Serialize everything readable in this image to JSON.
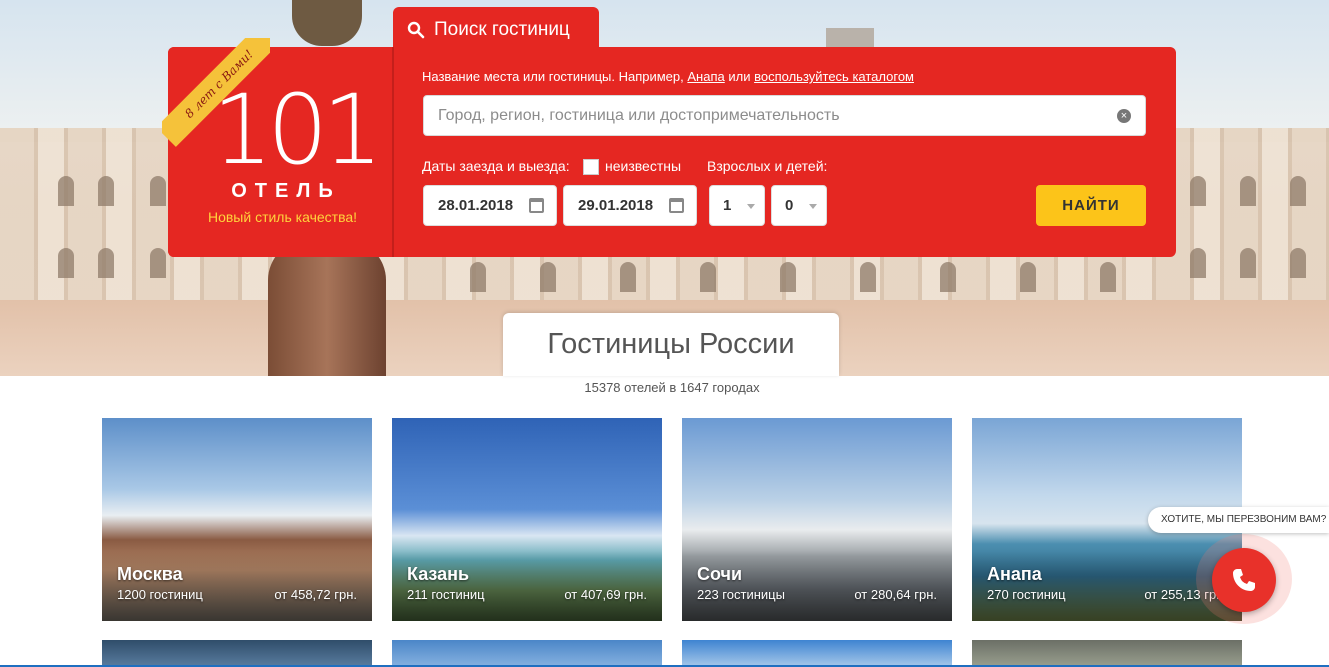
{
  "search_tab": {
    "label": "Поиск гостиниц"
  },
  "logo": {
    "ribbon": "8 лет с Вами!",
    "number": "101",
    "word": "ОТЕЛЬ",
    "tagline": "Новый стиль качества!"
  },
  "search": {
    "hint_prefix": "Название места или гостиницы. Например,",
    "hint_example": "Анапа",
    "hint_middle": "или",
    "hint_catalog": "воспользуйтесь каталогом",
    "placeholder": "Город, регион, гостиница или достопримечательность",
    "dates_label": "Даты заезда и выезда:",
    "unknown_label": "неизвестны",
    "guests_label": "Взрослых и детей:",
    "checkin": "28.01.2018",
    "checkout": "29.01.2018",
    "adults": "1",
    "children": "0",
    "find_button": "НАЙТИ"
  },
  "section": {
    "title": "Гостиницы России",
    "subtitle": "15378 отелей в 1647 городах"
  },
  "cities": [
    {
      "name": "Москва",
      "count": "1200 гостиниц",
      "price": "от 458,72 грн."
    },
    {
      "name": "Казань",
      "count": "211 гостиниц",
      "price": "от 407,69 грн."
    },
    {
      "name": "Сочи",
      "count": "223 гостиницы",
      "price": "от 280,64 грн."
    },
    {
      "name": "Анапа",
      "count": "270 гостиниц",
      "price": "от 255,13 грн."
    }
  ],
  "callback": {
    "bubble": "ХОТИТЕ, МЫ ПЕРЕЗВОНИМ ВАМ?",
    "icon": "phone-icon"
  },
  "colors": {
    "brand_red": "#e52722",
    "accent_yellow": "#fcc419",
    "tagline_yellow": "#ffd33c"
  }
}
